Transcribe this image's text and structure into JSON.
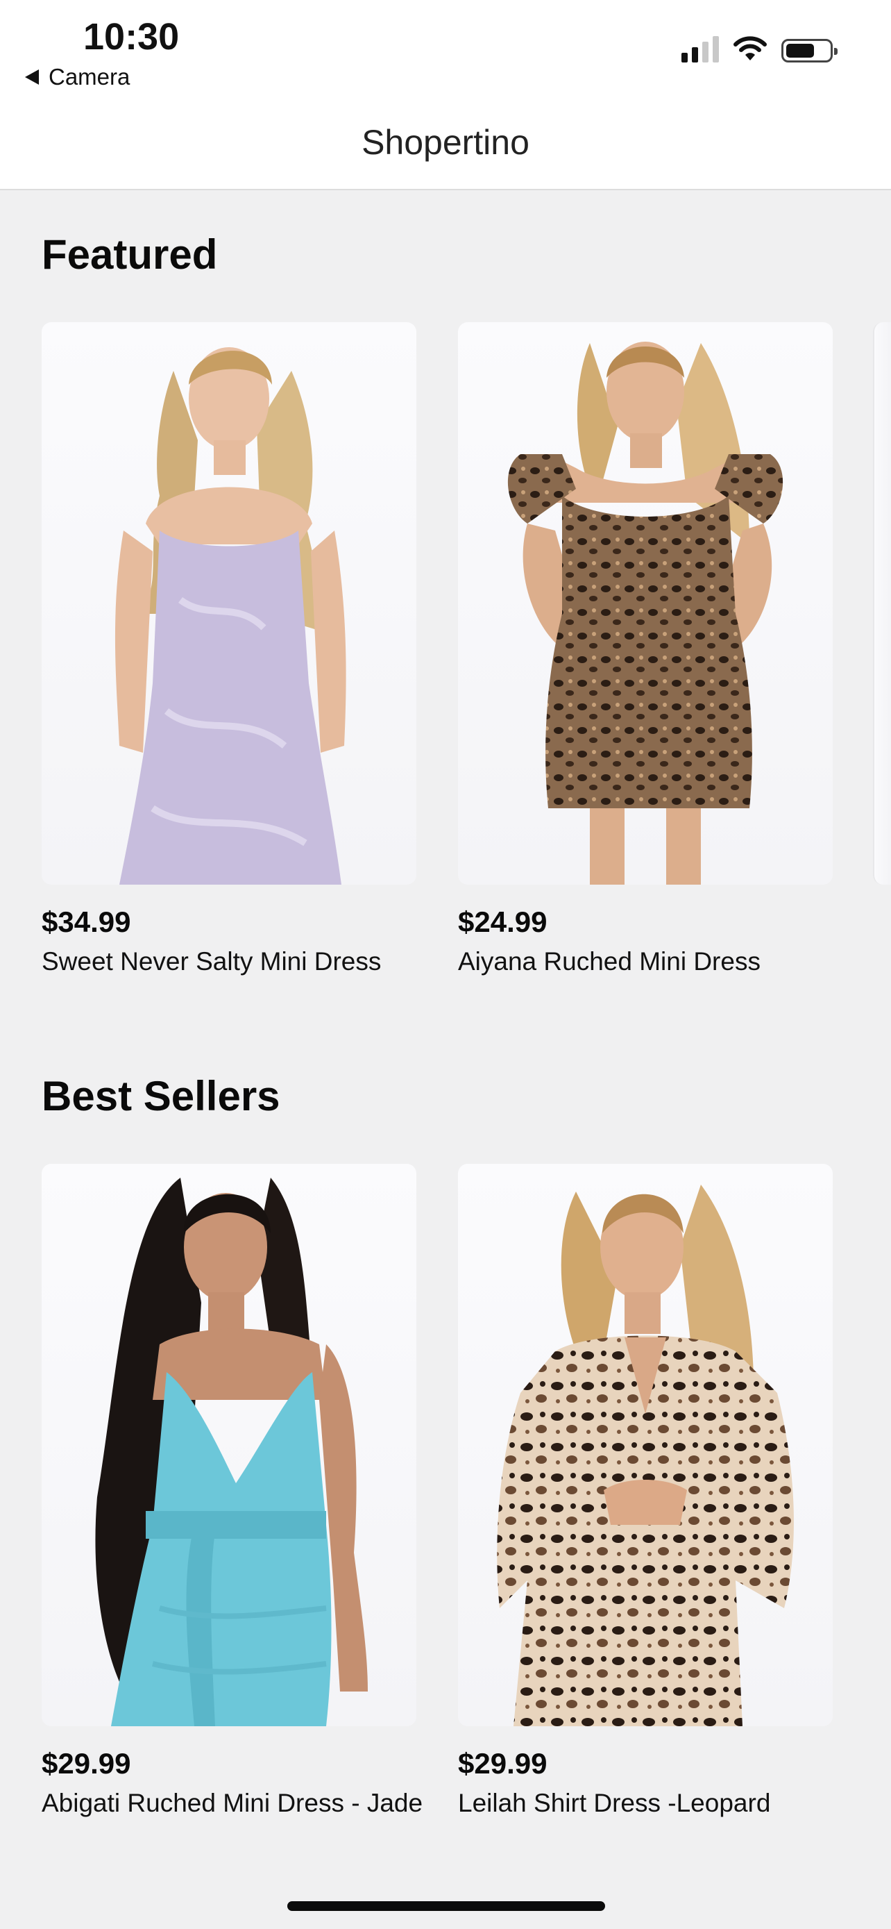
{
  "status_bar": {
    "time": "10:30",
    "back_label": "Camera",
    "icons": [
      "cellular-signal-icon",
      "wifi-icon",
      "battery-icon"
    ]
  },
  "navbar": {
    "title": "Shopertino"
  },
  "sections": [
    {
      "title": "Featured",
      "items": [
        {
          "price": "$34.99",
          "name": "Sweet Never Salty Mini Dress",
          "image": "model-lavender-dress-photo"
        },
        {
          "price": "$24.99",
          "name": "Aiyana Ruched Mini Dress",
          "image": "model-leopard-mini-dress-photo"
        }
      ]
    },
    {
      "title": "Best Sellers",
      "items": [
        {
          "price": "$29.99",
          "name": "Abigati Ruched Mini Dress - Jade",
          "image": "model-jade-dress-photo"
        },
        {
          "price": "$29.99",
          "name": "Leilah Shirt Dress -Leopard",
          "image": "model-leopard-shirt-dress-photo"
        }
      ]
    }
  ],
  "colors": {
    "background": "#f0f0f1",
    "navbar_background": "#ffffff",
    "text": "#0a0a0a",
    "dress_lavender": "#c7bddd",
    "dress_jade": "#6cc7d9",
    "leopard_base": "#8a6a4e"
  }
}
